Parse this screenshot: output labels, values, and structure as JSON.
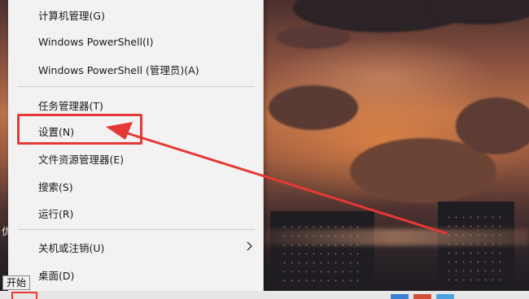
{
  "context_menu": {
    "items": [
      {
        "label": "计算机管理(G)"
      },
      {
        "label": "Windows PowerShell(I)"
      },
      {
        "label": "Windows PowerShell (管理员)(A)"
      },
      {
        "label": "任务管理器(T)"
      },
      {
        "label": "设置(N)"
      },
      {
        "label": "文件资源管理器(E)"
      },
      {
        "label": "搜索(S)"
      },
      {
        "label": "运行(R)"
      },
      {
        "label": "关机或注销(U)",
        "icon": "chevron-right-icon"
      },
      {
        "label": "桌面(D)"
      }
    ]
  },
  "tooltip": {
    "text": "开始"
  },
  "desktop": {
    "edge_text": "优"
  },
  "annotation": {
    "color": "#e53935"
  }
}
